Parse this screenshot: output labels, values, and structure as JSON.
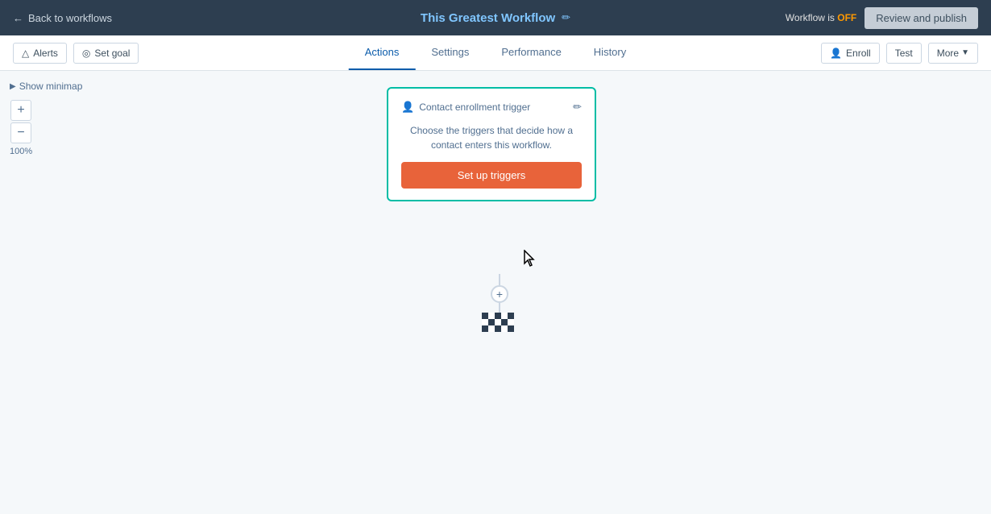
{
  "topBar": {
    "backLabel": "Back to workflows",
    "workflowTitle": "This Greatest Workflow",
    "editIcon": "✏",
    "workflowStatusLabel": "Workflow is",
    "workflowStatusValue": "OFF",
    "reviewButtonLabel": "Review and publish"
  },
  "actionBar": {
    "alertsLabel": "Alerts",
    "setGoalLabel": "Set goal",
    "tabs": [
      {
        "id": "actions",
        "label": "Actions",
        "active": true
      },
      {
        "id": "settings",
        "label": "Settings",
        "active": false
      },
      {
        "id": "performance",
        "label": "Performance",
        "active": false
      },
      {
        "id": "history",
        "label": "History",
        "active": false
      }
    ],
    "enrollLabel": "Enroll",
    "testLabel": "Test",
    "moreLabel": "More"
  },
  "canvas": {
    "minimapLabel": "Show minimap",
    "zoomIn": "+",
    "zoomOut": "−",
    "zoomLevel": "100%"
  },
  "triggerCard": {
    "headerLabel": "Contact enrollment trigger",
    "bodyText": "Choose the triggers that decide how a contact enters this workflow.",
    "buttonLabel": "Set up triggers",
    "editIcon": "✏"
  },
  "checkered": {
    "pattern": [
      "black",
      "white",
      "black",
      "white",
      "black",
      "white",
      "black",
      "white",
      "black",
      "white",
      "black",
      "white",
      "black",
      "white",
      "black"
    ]
  }
}
